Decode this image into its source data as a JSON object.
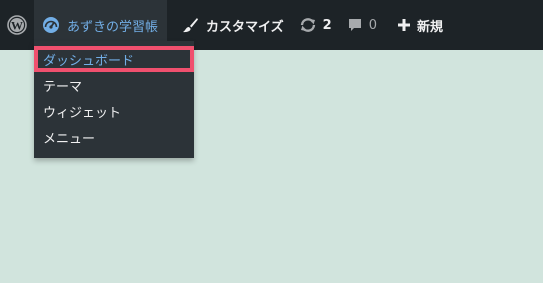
{
  "adminbar": {
    "wp_logo_icon": "wordpress-logo-icon",
    "site_name": "あずきの学習帳",
    "site_icon": "dashboard-gauge-icon",
    "customize_label": "カスタマイズ",
    "customize_icon": "paintbrush-icon",
    "updates_count": "2",
    "updates_icon": "refresh-icon",
    "comments_count": "0",
    "comments_icon": "speech-bubble-icon",
    "new_label": "新規",
    "new_icon": "plus-icon"
  },
  "dropdown": {
    "items": [
      {
        "label": "ダッシュボード",
        "active": true
      },
      {
        "label": "テーマ"
      },
      {
        "label": "ウィジェット"
      },
      {
        "label": "メニュー"
      }
    ]
  },
  "colors": {
    "bar_bg": "#1d2327",
    "submenu_bg": "#2c3338",
    "accent": "#72aee6",
    "highlight_border": "#f0506e",
    "page_bg": "#d1e4dd"
  }
}
